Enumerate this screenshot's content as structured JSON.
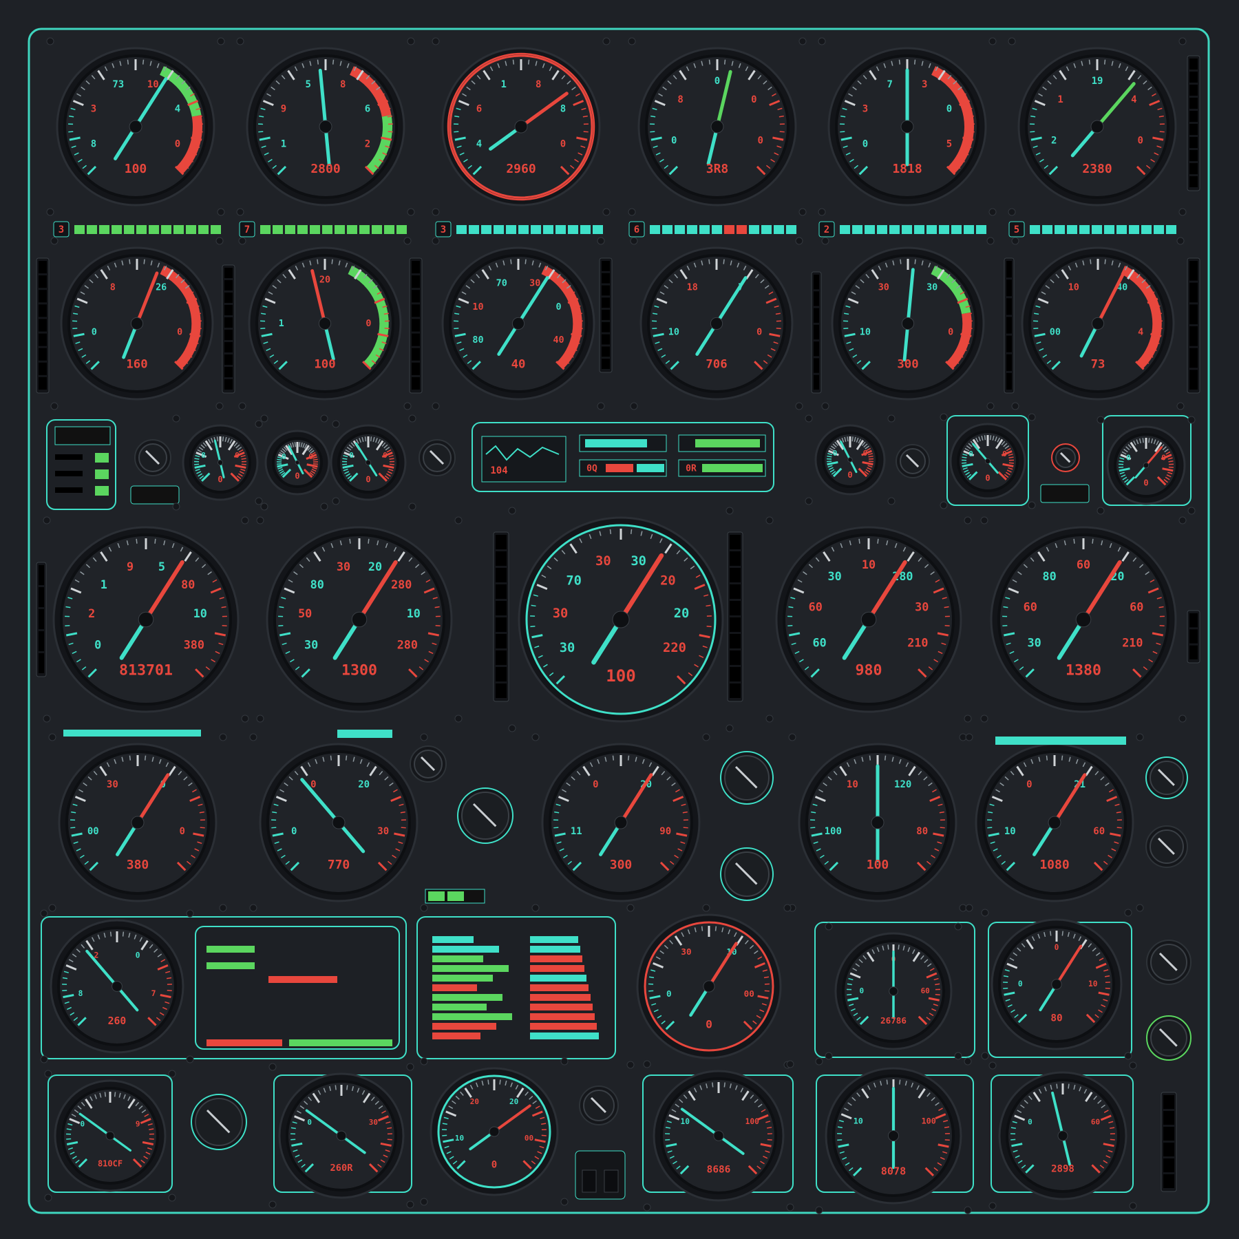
{
  "theme": {
    "background": "#1e2126",
    "panel_border": "#3fd6bf",
    "bezel": "#15171b",
    "face": "#202328",
    "teal": "#3fe0c8",
    "green": "#5bd65f",
    "red": "#e8473d",
    "amber": "#c9d94a"
  },
  "row1": {
    "gauges": [
      {
        "ticks": [
          "8",
          "3",
          "73",
          "10",
          "4",
          "0"
        ],
        "value": 0.62,
        "readout": "100",
        "arc": "green-red",
        "needle_color": "teal"
      },
      {
        "ticks": [
          "1",
          "9",
          "5",
          "8",
          "6",
          "2"
        ],
        "value": 0.48,
        "readout": "2800",
        "arc": "red-green",
        "needle_color": "teal"
      },
      {
        "ticks": [
          "4",
          "6",
          "1",
          "8",
          "8",
          "0"
        ],
        "value": 0.7,
        "readout": "2960",
        "arc": "red-ring",
        "needle_color": "red"
      },
      {
        "ticks": [
          "0",
          "8",
          "0",
          "0",
          "0"
        ],
        "value": 0.55,
        "readout": "3R8",
        "arc": "none",
        "needle_color": "green"
      },
      {
        "ticks": [
          "0",
          "3",
          "7",
          "3",
          "0",
          "5"
        ],
        "value": 0.5,
        "readout": "1818",
        "arc": "red",
        "needle_color": "teal"
      },
      {
        "ticks": [
          "2",
          "1",
          "19",
          "4",
          "0"
        ],
        "value": 0.65,
        "readout": "2380",
        "arc": "none",
        "needle_color": "green"
      }
    ],
    "bar_indicators": [
      {
        "tag": "3",
        "segments": [
          "g",
          "g",
          "g",
          "g",
          "g",
          "g",
          "g",
          "g",
          "g",
          "g",
          "g",
          "g"
        ]
      },
      {
        "tag": "7",
        "segments": [
          "g",
          "g",
          "g",
          "g",
          "g",
          "g",
          "g",
          "g",
          "g",
          "g",
          "g",
          "g"
        ]
      },
      {
        "tag": "3",
        "segments": [
          "t",
          "t",
          "t",
          "t",
          "t",
          "t",
          "t",
          "t",
          "t",
          "t",
          "t",
          "t"
        ]
      },
      {
        "tag": "6",
        "segments": [
          "t",
          "t",
          "t",
          "t",
          "t",
          "t",
          "r",
          "r",
          "t",
          "t",
          "t",
          "t"
        ]
      },
      {
        "tag": "2",
        "segments": [
          "t",
          "t",
          "t",
          "t",
          "t",
          "t",
          "t",
          "t",
          "t",
          "t",
          "t",
          "t"
        ]
      },
      {
        "tag": "5",
        "segments": [
          "t",
          "t",
          "t",
          "t",
          "t",
          "t",
          "t",
          "t",
          "t",
          "t",
          "t",
          "t"
        ]
      }
    ]
  },
  "row2": {
    "gauges": [
      {
        "ticks": [
          "0",
          "8",
          "26",
          "0"
        ],
        "value": 0.58,
        "readout": "160",
        "arc": "red",
        "needle_color": "red"
      },
      {
        "ticks": [
          "1",
          "20",
          "0"
        ],
        "value": 0.45,
        "readout": "100",
        "arc": "green",
        "needle_color": "red"
      },
      {
        "ticks": [
          "80",
          "10",
          "70",
          "30",
          "0",
          "40"
        ],
        "value": 0.62,
        "readout": "40",
        "arc": "red",
        "needle_color": "teal"
      },
      {
        "ticks": [
          "10",
          "18",
          "7",
          "0"
        ],
        "value": 0.62,
        "readout": "706",
        "arc": "none",
        "needle_color": "teal"
      },
      {
        "ticks": [
          "10",
          "30",
          "30",
          "0"
        ],
        "value": 0.52,
        "readout": "300",
        "arc": "green-red",
        "needle_color": "teal"
      },
      {
        "ticks": [
          "00",
          "10",
          "40",
          "4"
        ],
        "value": 0.6,
        "readout": "73",
        "arc": "red",
        "needle_color": "red"
      }
    ]
  },
  "row3": {
    "display_values": [
      "104",
      "0Q",
      "0R"
    ],
    "small_gauges": [
      {
        "ticks": [
          "8",
          "0"
        ],
        "value": 0.45,
        "readout": "0"
      },
      {
        "ticks": [
          "0",
          "0"
        ],
        "value": 0.4,
        "readout": "0"
      },
      {
        "ticks": [
          "0",
          "0"
        ],
        "value": 0.38,
        "readout": "0"
      }
    ],
    "small_right": [
      {
        "ticks": [
          "0",
          "0"
        ],
        "value": 0.4,
        "readout": "0"
      },
      {
        "ticks": [
          "0",
          "0"
        ],
        "value": 0.35,
        "readout": "0"
      },
      {
        "ticks": [
          "0",
          "0"
        ],
        "value": 0.65,
        "readout": "0"
      }
    ]
  },
  "row4": {
    "gauges": [
      {
        "ticks": [
          "0",
          "2",
          "1",
          "9",
          "5",
          "80",
          "10",
          "380"
        ],
        "value": 0.62,
        "readout": "813701"
      },
      {
        "ticks": [
          "30",
          "50",
          "80",
          "30",
          "20",
          "280",
          "10",
          "280"
        ],
        "value": 0.62,
        "readout": "1300"
      },
      {
        "ticks": [
          "30",
          "30",
          "70",
          "30",
          "30",
          "20",
          "20",
          "220"
        ],
        "value": 0.62,
        "readout": "100"
      },
      {
        "ticks": [
          "60",
          "60",
          "30",
          "10",
          "280",
          "30",
          "210"
        ],
        "value": 0.62,
        "readout": "980"
      },
      {
        "ticks": [
          "30",
          "60",
          "80",
          "60",
          "20",
          "60",
          "210"
        ],
        "value": 0.62,
        "readout": "1380"
      }
    ]
  },
  "row5": {
    "gauges": [
      {
        "ticks": [
          "00",
          "30",
          "0",
          "0"
        ],
        "value": 0.62,
        "readout": "380"
      },
      {
        "ticks": [
          "0",
          "0",
          "20",
          "30"
        ],
        "value": 0.35,
        "readout": "770"
      },
      {
        "ticks": [
          "11",
          "0",
          "20",
          "90"
        ],
        "value": 0.62,
        "readout": "300"
      },
      {
        "ticks": [
          "100",
          "10",
          "120",
          "80"
        ],
        "value": 0.5,
        "readout": "100"
      },
      {
        "ticks": [
          "10",
          "0",
          "21",
          "60"
        ],
        "value": 0.62,
        "readout": "1080"
      }
    ]
  },
  "row6": {
    "gauges": [
      {
        "ticks": [
          "8",
          "2",
          "0",
          "7"
        ],
        "value": 0.35,
        "readout": "260"
      },
      {
        "ticks": [
          "0",
          "30",
          "10",
          "00"
        ],
        "value": 0.62,
        "readout": "0"
      },
      {
        "ticks": [
          "0",
          "0",
          "60"
        ],
        "value": 0.5,
        "readout": "26786"
      },
      {
        "ticks": [
          "0",
          "0",
          "10"
        ],
        "value": 0.62,
        "readout": "80"
      }
    ]
  },
  "row7": {
    "gauges": [
      {
        "ticks": [
          "0",
          "9"
        ],
        "value": 0.3,
        "readout": "810CF"
      },
      {
        "ticks": [
          "0",
          "30"
        ],
        "value": 0.3,
        "readout": "260R"
      },
      {
        "ticks": [
          "10",
          "20",
          "20",
          "00"
        ],
        "value": 0.7,
        "readout": "0"
      },
      {
        "ticks": [
          "10",
          "100"
        ],
        "value": 0.3,
        "readout": "8686"
      },
      {
        "ticks": [
          "10",
          "100"
        ],
        "value": 0.5,
        "readout": "8078"
      },
      {
        "ticks": [
          "0",
          "60"
        ],
        "value": 0.45,
        "readout": "2898"
      }
    ]
  }
}
